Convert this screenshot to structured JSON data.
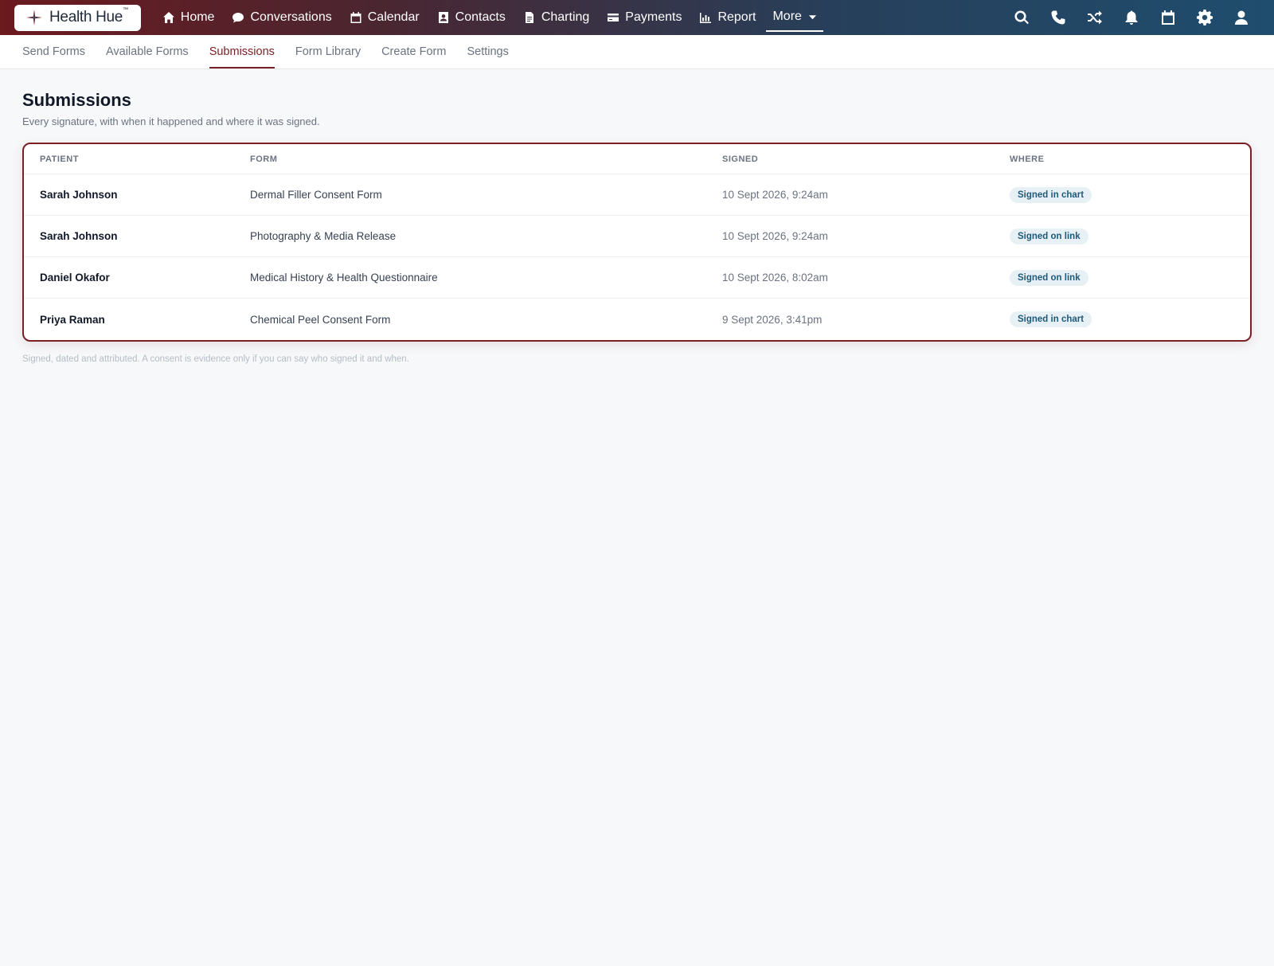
{
  "app": {
    "name": "Health Hue",
    "trademark": "™"
  },
  "nav": {
    "items": [
      {
        "label": "Home",
        "icon": "home-icon"
      },
      {
        "label": "Conversations",
        "icon": "chat-bubble-icon"
      },
      {
        "label": "Calendar",
        "icon": "calendar-icon"
      },
      {
        "label": "Contacts",
        "icon": "contact-card-icon"
      },
      {
        "label": "Charting",
        "icon": "document-icon"
      },
      {
        "label": "Payments",
        "icon": "credit-card-icon"
      },
      {
        "label": "Report",
        "icon": "bar-chart-icon"
      }
    ],
    "more_label": "More",
    "right_icons": [
      "search-icon",
      "phone-icon",
      "shuffle-icon",
      "bell-icon",
      "calendar-icon",
      "gear-icon",
      "user-icon"
    ]
  },
  "subnav": {
    "tabs": [
      {
        "label": "Send Forms"
      },
      {
        "label": "Available Forms"
      },
      {
        "label": "Submissions",
        "active": true
      },
      {
        "label": "Form Library"
      },
      {
        "label": "Create Form"
      },
      {
        "label": "Settings"
      }
    ]
  },
  "page": {
    "title": "Submissions",
    "subtitle": "Every signature, with when it happened and where it was signed.",
    "footnote": "Signed, dated and attributed. A consent is evidence only if you can say who signed it and when."
  },
  "table": {
    "headers": {
      "patient": "Patient",
      "form": "Form",
      "signed": "Signed",
      "where": "Where"
    },
    "rows": [
      {
        "patient": "Sarah Johnson",
        "form": "Dermal Filler Consent Form",
        "signed": "10 Sept 2026, 9:24am",
        "where": "Signed in chart"
      },
      {
        "patient": "Sarah Johnson",
        "form": "Photography & Media Release",
        "signed": "10 Sept 2026, 9:24am",
        "where": "Signed on link"
      },
      {
        "patient": "Daniel Okafor",
        "form": "Medical History & Health Questionnaire",
        "signed": "10 Sept 2026, 8:02am",
        "where": "Signed on link"
      },
      {
        "patient": "Priya Raman",
        "form": "Chemical Peel Consent Form",
        "signed": "9 Sept 2026, 3:41pm",
        "where": "Signed in chart"
      }
    ]
  },
  "colors": {
    "accent": "#7a1f24",
    "badge_text": "#1f5a7a",
    "badge_bg": "#e6f0f5"
  }
}
